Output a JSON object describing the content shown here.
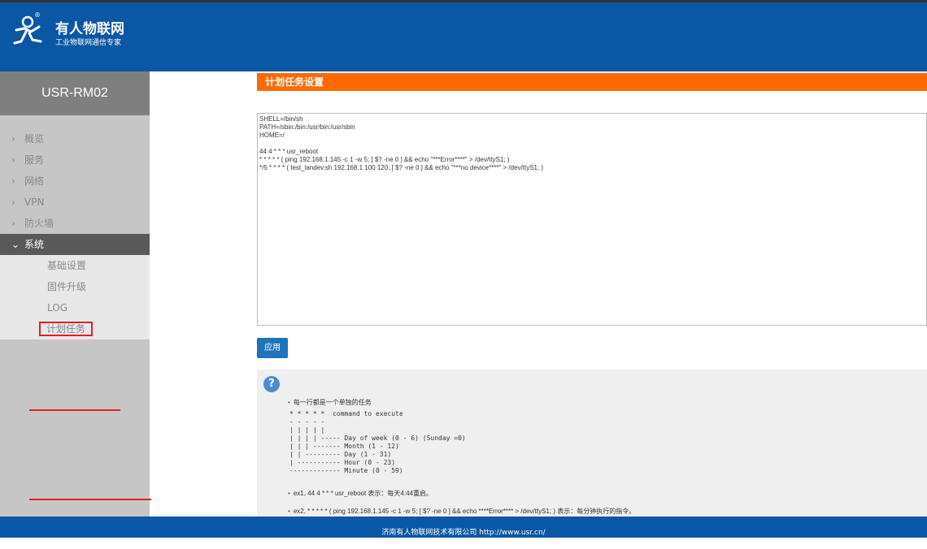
{
  "header": {
    "brand_name": "有人物联网",
    "brand_sub": "工业物联网通信专家",
    "logo_mark": "®"
  },
  "sidebar": {
    "model": "USR-RM02",
    "items": [
      {
        "label": "概览",
        "icon": "chevron-right-icon"
      },
      {
        "label": "服务",
        "icon": "chevron-right-icon"
      },
      {
        "label": "网络",
        "icon": "chevron-right-icon"
      },
      {
        "label": "VPN",
        "icon": "chevron-right-icon"
      },
      {
        "label": "防火墙",
        "icon": "chevron-right-icon"
      },
      {
        "label": "系统",
        "icon": "chevron-down-icon",
        "active": true
      }
    ],
    "sub_items": [
      {
        "label": "基础设置"
      },
      {
        "label": "固件升级"
      },
      {
        "label": "LOG"
      },
      {
        "label": "计划任务",
        "selected": true
      }
    ]
  },
  "main": {
    "title": "计划任务设置",
    "crontab": "SHELL=/bin/sh\nPATH=/sbin:/bin:/usr/bin:/usr/sbin\nHOME=/\n\n44 4 * * * usr_reboot\n* * * * * ( ping 192.168.1.145 -c 1 -w 5; [ $? -ne 0 ] && echo \"***Error****\" > /dev/ttyS1; )\n*/5 * * * * ( test_landev.sh 192.168.1 100 120; [ $? -ne 0 ] && echo \"***no device****\" > /dev/ttyS1; )",
    "apply_label": "应用"
  },
  "help": {
    "icon": "question-icon",
    "bullet1": "每一行都是一个单独的任务",
    "cron_diagram": "* * * * *  command to execute\n- - - - -\n| | | | |\n| | | | ----- Day of week (0 - 6) (Sunday =0)\n| | | ------- Month (1 - 12)\n| | --------- Day (1 - 31)\n| ----------- Hour (0 - 23)\n------------- Minute (0 - 59)",
    "bullet2": "ex1,  44 4 * * * usr_reboot 表示：每天4:44重启。",
    "bullet3": "ex2,  * * * * * ( ping 192.168.1.145 -c 1 -w 5; [ $? -ne 0 ] && echo ****Error**** > /dev/ttyS1; ) 表示：每分钟执行的指令。"
  },
  "footer": {
    "text": "济南有人物联网技术有限公司  http://www.usr.cn/"
  }
}
